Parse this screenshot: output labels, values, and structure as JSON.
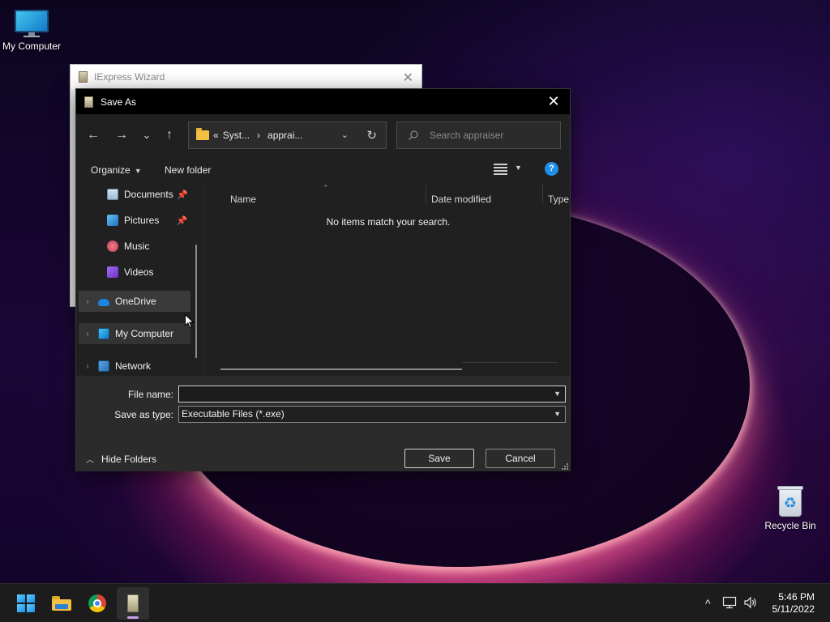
{
  "desktop": {
    "icons": [
      {
        "label": "My Computer"
      },
      {
        "label": "Recycle Bin"
      }
    ]
  },
  "background_window": {
    "title": "IExpress Wizard",
    "close_glyph": "✕"
  },
  "dialog": {
    "title": "Save As",
    "close_glyph": "✕",
    "nav": {
      "back_glyph": "←",
      "forward_glyph": "→",
      "recent_glyph": "⌄",
      "up_glyph": "↑"
    },
    "address": {
      "overflow": "«",
      "crumbs": [
        "Syst...",
        "apprai..."
      ],
      "separator": "›",
      "dropdown_glyph": "⌄",
      "refresh_glyph": "↻"
    },
    "search": {
      "placeholder": "Search appraiser"
    },
    "toolbar": {
      "organize_label": "Organize",
      "new_folder_label": "New folder",
      "help_glyph": "?"
    },
    "navpane": {
      "items": [
        {
          "label": "Documents",
          "icon": "documents-icon",
          "pinned": true
        },
        {
          "label": "Pictures",
          "icon": "pictures-icon",
          "pinned": true
        },
        {
          "label": "Music",
          "icon": "music-icon"
        },
        {
          "label": "Videos",
          "icon": "videos-icon"
        },
        {
          "label": "OneDrive",
          "icon": "onedrive-icon",
          "expandable": true,
          "state": "hover"
        },
        {
          "label": "My Computer",
          "icon": "my-computer-icon",
          "expandable": true,
          "state": "selected"
        },
        {
          "label": "Network",
          "icon": "network-icon",
          "expandable": true
        }
      ]
    },
    "filelist": {
      "columns": [
        "Name",
        "Date modified",
        "Type"
      ],
      "empty_message": "No items match your search."
    },
    "form": {
      "file_name_label": "File name:",
      "file_name_value": "",
      "save_as_type_label": "Save as type:",
      "save_as_type_value": "Executable Files (*.exe)"
    },
    "hide_folders_label": "Hide Folders",
    "save_label": "Save",
    "cancel_label": "Cancel"
  },
  "taskbar": {
    "apps": [
      "start-icon",
      "file-explorer-icon",
      "chrome-icon",
      "iexpress-icon"
    ],
    "tray": {
      "chevron_glyph": "^",
      "volume_glyph": "🔊"
    },
    "time": "5:46 PM",
    "date": "5/11/2022"
  },
  "colors": {
    "accent": "#1f8ee8",
    "dialog_bg": "#202020",
    "titlebar_bg": "#000000",
    "taskbar_bg": "#1c1c1c"
  }
}
